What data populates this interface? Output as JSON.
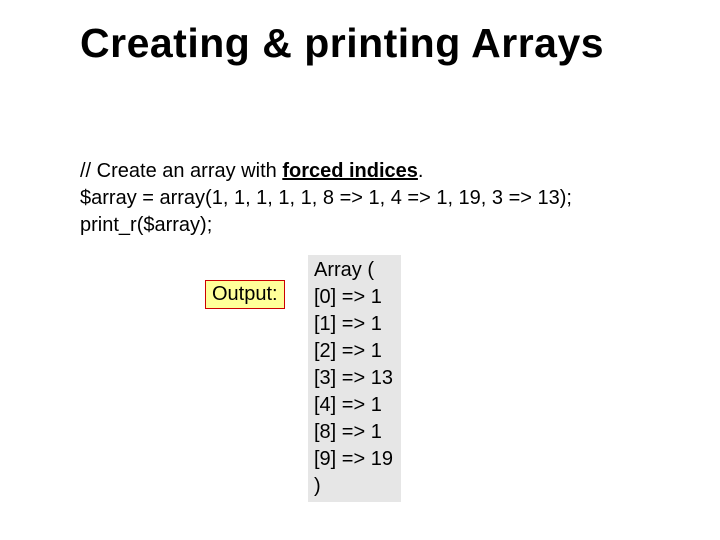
{
  "title": "Creating & printing Arrays",
  "code": {
    "comment_prefix": "// Create an array with ",
    "comment_forced": "forced indices",
    "comment_suffix": ".",
    "line2": "$array = array(1, 1, 1, 1,  1, 8 => 1,  4 => 1, 19, 3 => 13);",
    "line3": "print_r($array);"
  },
  "output_label": "Output:",
  "output": {
    "l0": "Array (",
    "l1": "[0] => 1",
    "l2": "[1] => 1",
    "l3": "[2] => 1",
    "l4": "[3] => 13",
    "l5": "[4] => 1",
    "l6": "[8] => 1",
    "l7": "[9] => 19",
    "l8": ")"
  }
}
